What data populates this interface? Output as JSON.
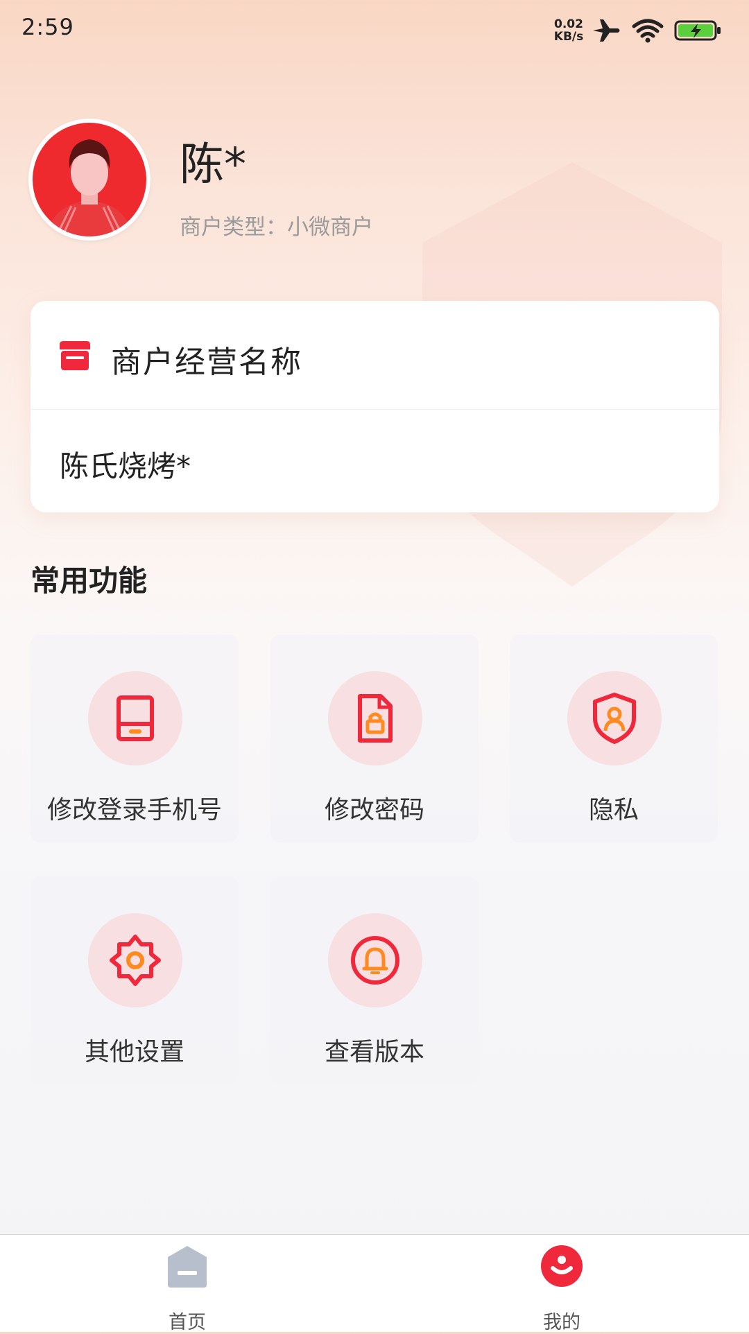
{
  "status_bar": {
    "time": "2:59",
    "net_speed_value": "0.02",
    "net_speed_unit": "KB/s",
    "icons": [
      "airplane-icon",
      "wifi-icon",
      "battery-charging-icon"
    ]
  },
  "profile": {
    "name": "陈*",
    "merchant_type": "商户类型：小微商户"
  },
  "merchant_card": {
    "title": "商户经营名称",
    "value": "陈氏烧烤*"
  },
  "functions": {
    "title": "常用功能",
    "items": [
      {
        "label": "修改登录手机号",
        "icon": "phone-icon"
      },
      {
        "label": "修改密码",
        "icon": "lock-document-icon"
      },
      {
        "label": "隐私",
        "icon": "privacy-shield-icon"
      },
      {
        "label": "其他设置",
        "icon": "gear-icon"
      },
      {
        "label": "查看版本",
        "icon": "bell-icon"
      }
    ]
  },
  "bottom_nav": {
    "items": [
      {
        "label": "首页",
        "icon": "home-icon",
        "active": false
      },
      {
        "label": "我的",
        "icon": "profile-smile-icon",
        "active": true
      }
    ]
  },
  "colors": {
    "accent": "#f0283c",
    "icon_orange": "#ff8a1f",
    "icon_circle_bg": "#f7dfe2",
    "inactive_nav": "#b8bfcc",
    "muted_text": "#9a9a9a"
  }
}
